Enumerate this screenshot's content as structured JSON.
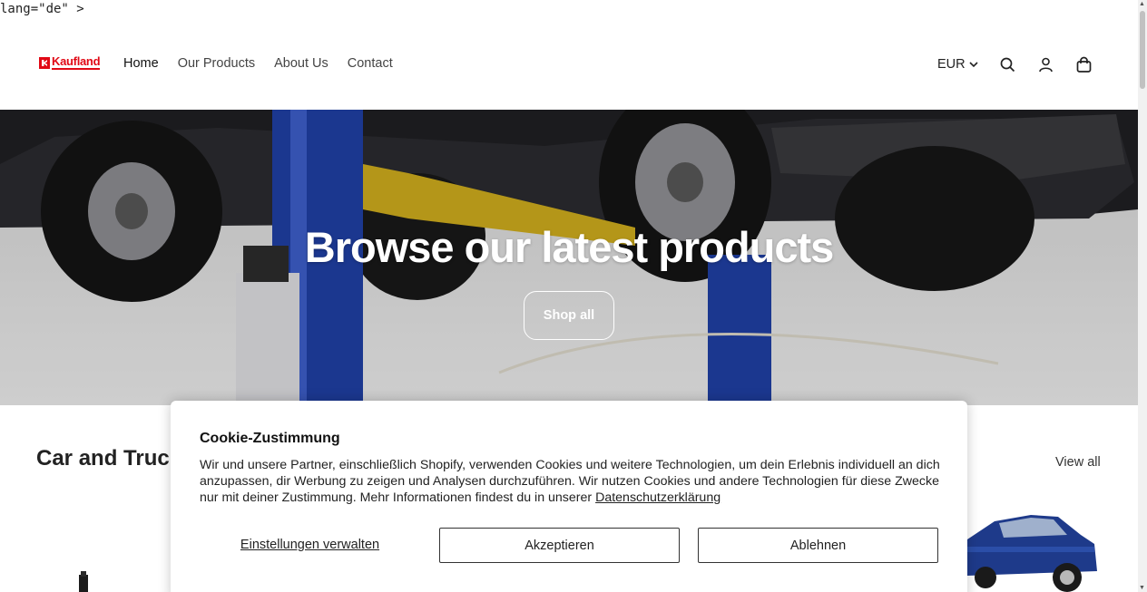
{
  "stray_text": "lang=\"de\" >",
  "brand": {
    "logo_text": "Kaufland",
    "color": "#e10915"
  },
  "nav": {
    "items": [
      {
        "label": "Home",
        "active": true
      },
      {
        "label": "Our Products"
      },
      {
        "label": "About Us"
      },
      {
        "label": "Contact"
      }
    ]
  },
  "header_right": {
    "currency": "EUR",
    "icons": [
      "search-icon",
      "account-icon",
      "cart-icon"
    ]
  },
  "hero": {
    "title": "Browse our latest products",
    "button_label": "Shop all"
  },
  "collection": {
    "title": "Car and Truc",
    "view_all_label": "View all"
  },
  "cookie_banner": {
    "title": "Cookie-Zustimmung",
    "body": "Wir und unsere Partner, einschließlich Shopify, verwenden Cookies und weitere Technologien, um dein Erlebnis individuell an dich anzupassen, dir Werbung zu zeigen und Analysen durchzuführen. Wir nutzen Cookies und andere Technologien für diese Zwecke nur mit deiner Zustimmung. Mehr Informationen findest du in unserer",
    "privacy_link": "Datenschutzerklärung",
    "manage_label": "Einstellungen verwalten",
    "accept_label": "Akzeptieren",
    "decline_label": "Ablehnen"
  }
}
